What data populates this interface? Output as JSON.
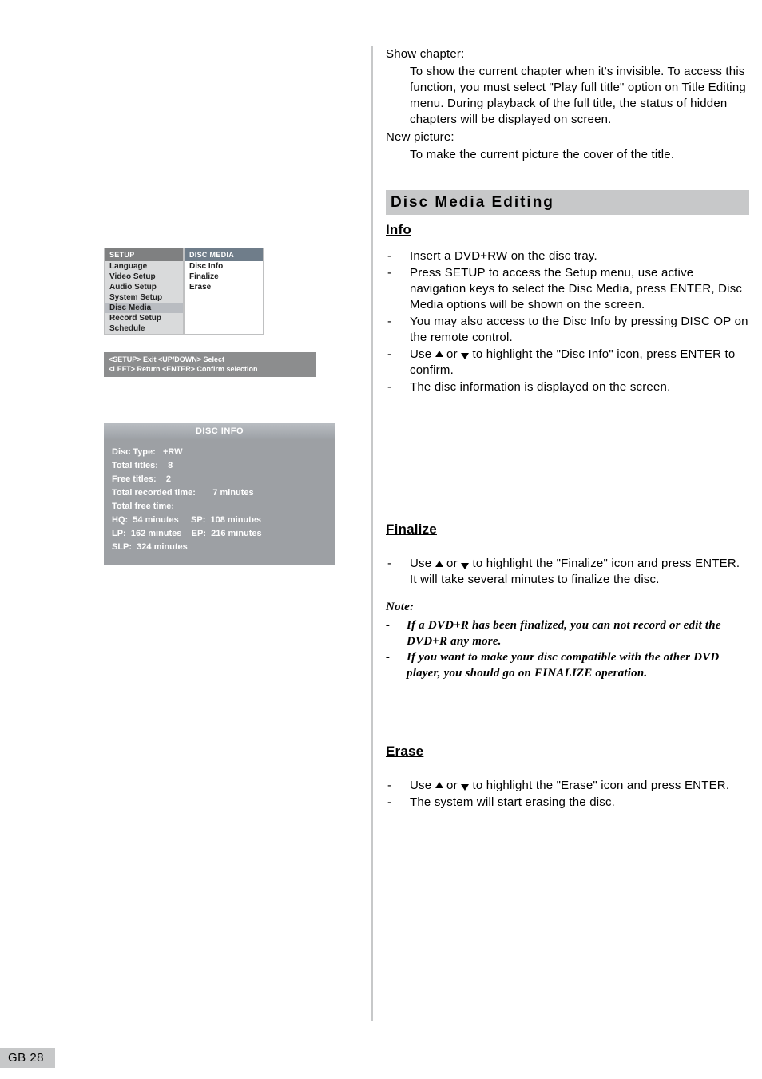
{
  "left": {
    "setup_menu": {
      "header_left": "SETUP",
      "header_right": "DISC MEDIA",
      "left_items": [
        "Language",
        "Video Setup",
        "Audio Setup",
        "System Setup",
        "Disc Media",
        "Record Setup",
        "Schedule"
      ],
      "right_items": [
        "Disc Info",
        "Finalize",
        "Erase"
      ],
      "hints_line1": "<SETUP> Exit   <UP/DOWN> Select",
      "hints_line2": "<LEFT> Return  <ENTER> Confirm selection"
    },
    "disc_info": {
      "header": "DISC INFO",
      "lines": [
        "Disc Type:   +RW",
        "Total titles:    8",
        "Free titles:    2",
        "Total recorded time:       7 minutes",
        "Total free time:",
        "HQ:  54 minutes     SP:  108 minutes",
        "LP:  162 minutes    EP:  216 minutes",
        "SLP:  324 minutes"
      ]
    }
  },
  "right": {
    "show_chapter_label": "Show chapter:",
    "show_chapter_body": "To show the current chapter when it's invisible. To access this function, you must select \"Play full title\" option on Title Editing menu. During playback of the full title, the status of hidden chapters will be displayed on screen.",
    "new_picture_label": "New picture:",
    "new_picture_body": "To make the current picture the cover of the title.",
    "section_title": "Disc Media Editing",
    "info_heading": "Info",
    "info_items": [
      "Insert a DVD+RW on the disc tray.",
      "Press SETUP to access the Setup menu, use active navigation keys to select the Disc Media, press ENTER, Disc Media options will be shown on the screen.",
      "You may also access to the Disc Info by pressing DISC OP on the remote control.",
      "__ARROWS__Use  or  to highlight the \"Disc Info\" icon, press ENTER to confirm.",
      "The disc information is displayed on the screen."
    ],
    "finalize_heading": "Finalize",
    "finalize_items": [
      "__ARROWS__Use  or  to highlight the \"Finalize\" icon and press ENTER. It will take several minutes to finalize the disc."
    ],
    "note_label": "Note:",
    "note_items": [
      "If a DVD+R has been finalized, you can not record or edit the DVD+R any more.",
      "If you want to make your disc compatible with the other DVD player, you should go on FINALIZE operation."
    ],
    "erase_heading": "Erase",
    "erase_items": [
      "__ARROWS__Use  or  to highlight the \"Erase\" icon and press ENTER.",
      "The system will start erasing the disc."
    ]
  },
  "page_number": "GB 28"
}
